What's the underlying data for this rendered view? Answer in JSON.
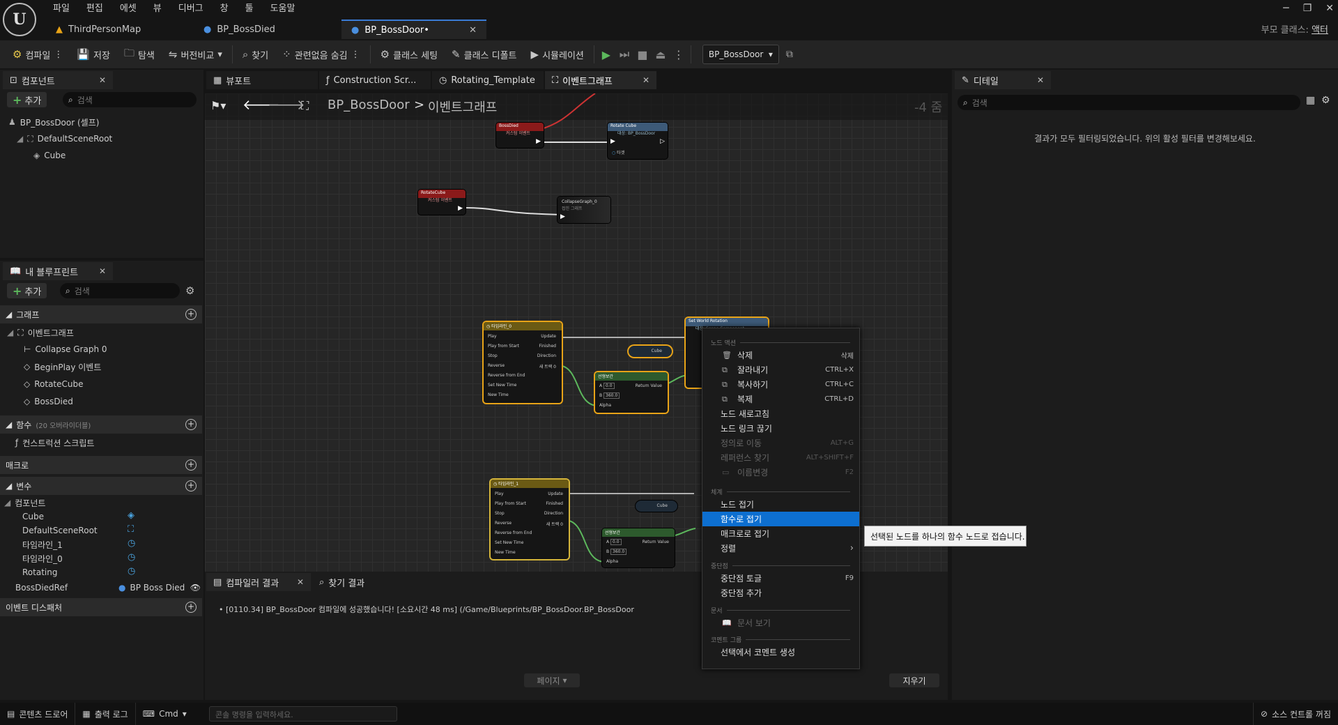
{
  "app": {
    "menus": [
      "파일",
      "편집",
      "에셋",
      "뷰",
      "디버그",
      "창",
      "툴",
      "도움말"
    ],
    "doc_tabs": [
      {
        "label": "ThirdPersonMap",
        "icon": "level-icon"
      },
      {
        "label": "BP_BossDied",
        "icon": "blueprint-icon"
      },
      {
        "label": "BP_BossDoor•",
        "icon": "blueprint-icon",
        "active": true
      }
    ],
    "parent_class_label": "부모 클래스:",
    "parent_class_value": "액터",
    "window_controls": [
      "─",
      "❐",
      "✕"
    ]
  },
  "toolbar": {
    "compile": "컴파일",
    "save": "저장",
    "browse": "탐색",
    "diff": "버전비교",
    "find": "찾기",
    "hide_unrelated": "관련없음 숨김",
    "class_settings": "클래스 세팅",
    "class_defaults": "클래스 디폴트",
    "simulation": "시뮬레이션",
    "debug_object": "BP_BossDoor"
  },
  "components_panel": {
    "title": "컴포넌트",
    "add": "추가",
    "search_placeholder": "검색",
    "tree": [
      "BP_BossDoor (셀프)",
      "DefaultSceneRoot",
      "Cube"
    ]
  },
  "my_blueprint": {
    "title": "내 블루프린트",
    "add": "추가",
    "search_placeholder": "검색",
    "graphs_header": "그래프",
    "event_graph": "이벤트그래프",
    "graph_items": [
      "Collapse Graph 0",
      "BeginPlay 이벤트",
      "RotateCube",
      "BossDied"
    ],
    "functions_header": "함수",
    "functions_count": "(20 오버라이더블)",
    "construction_script": "컨스트럭션 스크립트",
    "macros_header": "매크로",
    "variables_header": "변수",
    "components_sub": "컴포넌트",
    "variables": [
      "Cube",
      "DefaultSceneRoot",
      "타임라인_1",
      "타임라인_0",
      "Rotating"
    ],
    "boss_died_ref": "BossDiedRef",
    "boss_died_ref_type": "BP Boss Died",
    "event_dispatchers": "이벤트 디스패처"
  },
  "graph_tabs": [
    {
      "label": "뷰포트",
      "icon": "viewport-icon"
    },
    {
      "label": "Construction Scr...",
      "icon": "function-icon"
    },
    {
      "label": "Rotating_Template",
      "icon": "timeline-icon"
    },
    {
      "label": "이벤트그래프",
      "icon": "graph-icon",
      "active": true
    }
  ],
  "graph": {
    "breadcrumb_root": "BP_BossDoor",
    "breadcrumb_sep": ">",
    "breadcrumb_leaf": "이벤트그래프",
    "zoom": "-4 줌",
    "nodes": {
      "bossdied": {
        "title": "BossDied",
        "sub": "커스텀 이벤트"
      },
      "rotatecube_call": {
        "title": "Rotate Cube",
        "sub": "대상: BP_BossDoor",
        "target": "타겟"
      },
      "rotatecube_event": {
        "title": "RotateCube",
        "sub": "커스텀 이벤트"
      },
      "collapse": {
        "title": "CollapseGraph_0",
        "sub": "접힌 그래프"
      },
      "timeline0": {
        "title": "타임라인_0",
        "pins_in": [
          "Play",
          "Play from Start",
          "Stop",
          "Reverse",
          "Reverse from End",
          "Set New Time",
          "New Time"
        ],
        "pins_out": [
          "Update",
          "Finished",
          "Direction",
          "새 트랙 0"
        ]
      },
      "timeline1": {
        "title": "타임라인_1",
        "pins_in": [
          "Play",
          "Play from Start",
          "Stop",
          "Reverse",
          "Reverse from End",
          "Set New Time",
          "New Time"
        ],
        "pins_out": [
          "Update",
          "Finished",
          "Direction",
          "새 트랙 0"
        ]
      },
      "lerp0": {
        "title": "선형보간",
        "pins": [
          "A",
          "B",
          "Alpha"
        ],
        "out": "Return Value",
        "a": "0.0",
        "b": "360.0"
      },
      "lerp1": {
        "title": "선형보간",
        "pins": [
          "A",
          "B",
          "Alpha"
        ],
        "out": "Return Value",
        "a": "0.0",
        "b": "360.0"
      },
      "setrot": {
        "title": "Set World Rotation",
        "sub": "대상: Scene Component"
      },
      "cube": "Cube",
      "new_time_val": "0.0"
    }
  },
  "context_menu": {
    "section_node_actions": "노드 액션",
    "items_a": [
      {
        "label": "삭제",
        "shortcut": "삭제",
        "icon": "trash-icon"
      },
      {
        "label": "잘라내기",
        "shortcut": "CTRL+X",
        "icon": "cut-icon"
      },
      {
        "label": "복사하기",
        "shortcut": "CTRL+C",
        "icon": "copy-icon"
      },
      {
        "label": "복제",
        "shortcut": "CTRL+D",
        "icon": "duplicate-icon"
      },
      {
        "label": "노드 새로고침",
        "shortcut": ""
      },
      {
        "label": "노드 링크 끊기",
        "shortcut": ""
      },
      {
        "label": "정의로 이동",
        "shortcut": "ALT+G",
        "disabled": true
      },
      {
        "label": "레퍼런스 찾기",
        "shortcut": "ALT+SHIFT+F",
        "disabled": true
      },
      {
        "label": "이름변경",
        "shortcut": "F2",
        "disabled": true,
        "icon": "rename-icon"
      }
    ],
    "section_organize": "체계",
    "items_b": [
      {
        "label": "노드 접기"
      },
      {
        "label": "함수로 접기",
        "highlighted": true
      },
      {
        "label": "매크로로 접기"
      },
      {
        "label": "정렬",
        "submenu": true
      }
    ],
    "section_breakpoints": "중단점",
    "items_c": [
      {
        "label": "중단점 토글",
        "shortcut": "F9"
      },
      {
        "label": "중단점 추가"
      }
    ],
    "section_docs": "문서",
    "items_d": [
      {
        "label": "문서 보기",
        "disabled": true
      }
    ],
    "section_comment": "코멘트 그룹",
    "items_e": [
      {
        "label": "선택에서 코멘트 생성"
      }
    ]
  },
  "tooltip": "선택된 노드를 하나의 함수 노드로 접습니다.",
  "details_panel": {
    "title": "디테일",
    "search_placeholder": "검색",
    "empty_message": "결과가 모두 필터링되었습니다. 위의 활성 필터를 변경해보세요."
  },
  "bottom_panel": {
    "tab_compiler": "컴파일러 결과",
    "tab_find": "찾기 결과",
    "log_line": "[0110.34] BP_BossDoor 컴파일에 성공했습니다! [소요시간 48 ms] (/Game/Blueprints/BP_BossDoor.BP_BossDoor",
    "page_button": "페이지",
    "clear_button": "지우기"
  },
  "statusbar": {
    "content_drawer": "콘텐츠 드로어",
    "output_log": "출력 로그",
    "cmd": "Cmd",
    "console_placeholder": "콘솔 명령을 입력하세요.",
    "source_control": "소스 컨트롤 꺼짐"
  }
}
